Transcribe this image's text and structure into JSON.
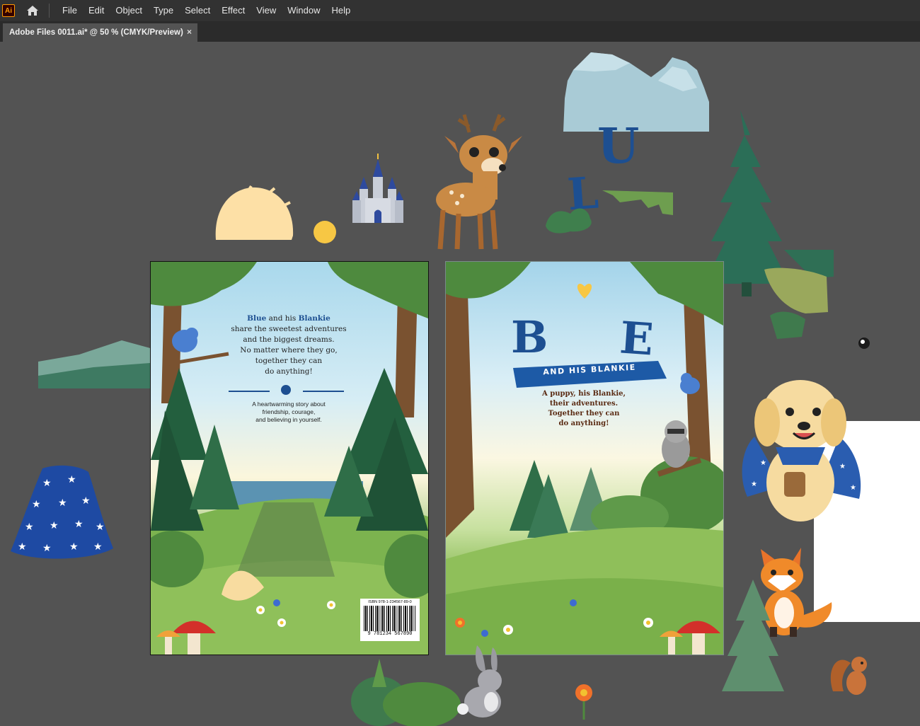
{
  "app": {
    "logo": "Ai"
  },
  "menu": [
    "File",
    "Edit",
    "Object",
    "Type",
    "Select",
    "Effect",
    "View",
    "Window",
    "Help"
  ],
  "document": {
    "tab_title": "Adobe Files 0011.ai* @ 50 % (CMYK/Preview)",
    "close_glyph": "×"
  },
  "back_cover": {
    "blurb_prefix_name": "Blue",
    "blurb_mid": "and his",
    "blurb_name2": "Blankie",
    "blurb_line2": "share the sweetest adventures",
    "blurb_line3": "and the biggest dreams.",
    "blurb_line4": "No matter where they go,",
    "blurb_line5": "together they can",
    "blurb_line6": "do anything!",
    "tagline_1": "A heartwarming story about",
    "tagline_2": "friendship, courage,",
    "tagline_3": "and believing in yourself.",
    "isbn": "ISBN 978-1-234567-89-0",
    "barcode_digits": "9 781234 567890"
  },
  "front_cover": {
    "title_letter_1": "B",
    "title_letter_2": "E",
    "banner": "AND HIS BLANKIE",
    "blurb_1": "A puppy, his Blankie,",
    "blurb_2": "their adventures.",
    "blurb_3": "Together they can",
    "blurb_4": "do anything!"
  },
  "loose_letters": {
    "u": "U",
    "l": "L"
  },
  "colors": {
    "ui_dark": "#323232",
    "canvas": "#535353",
    "accent": "#ff9a00",
    "title_blue": "#1d4f91"
  }
}
